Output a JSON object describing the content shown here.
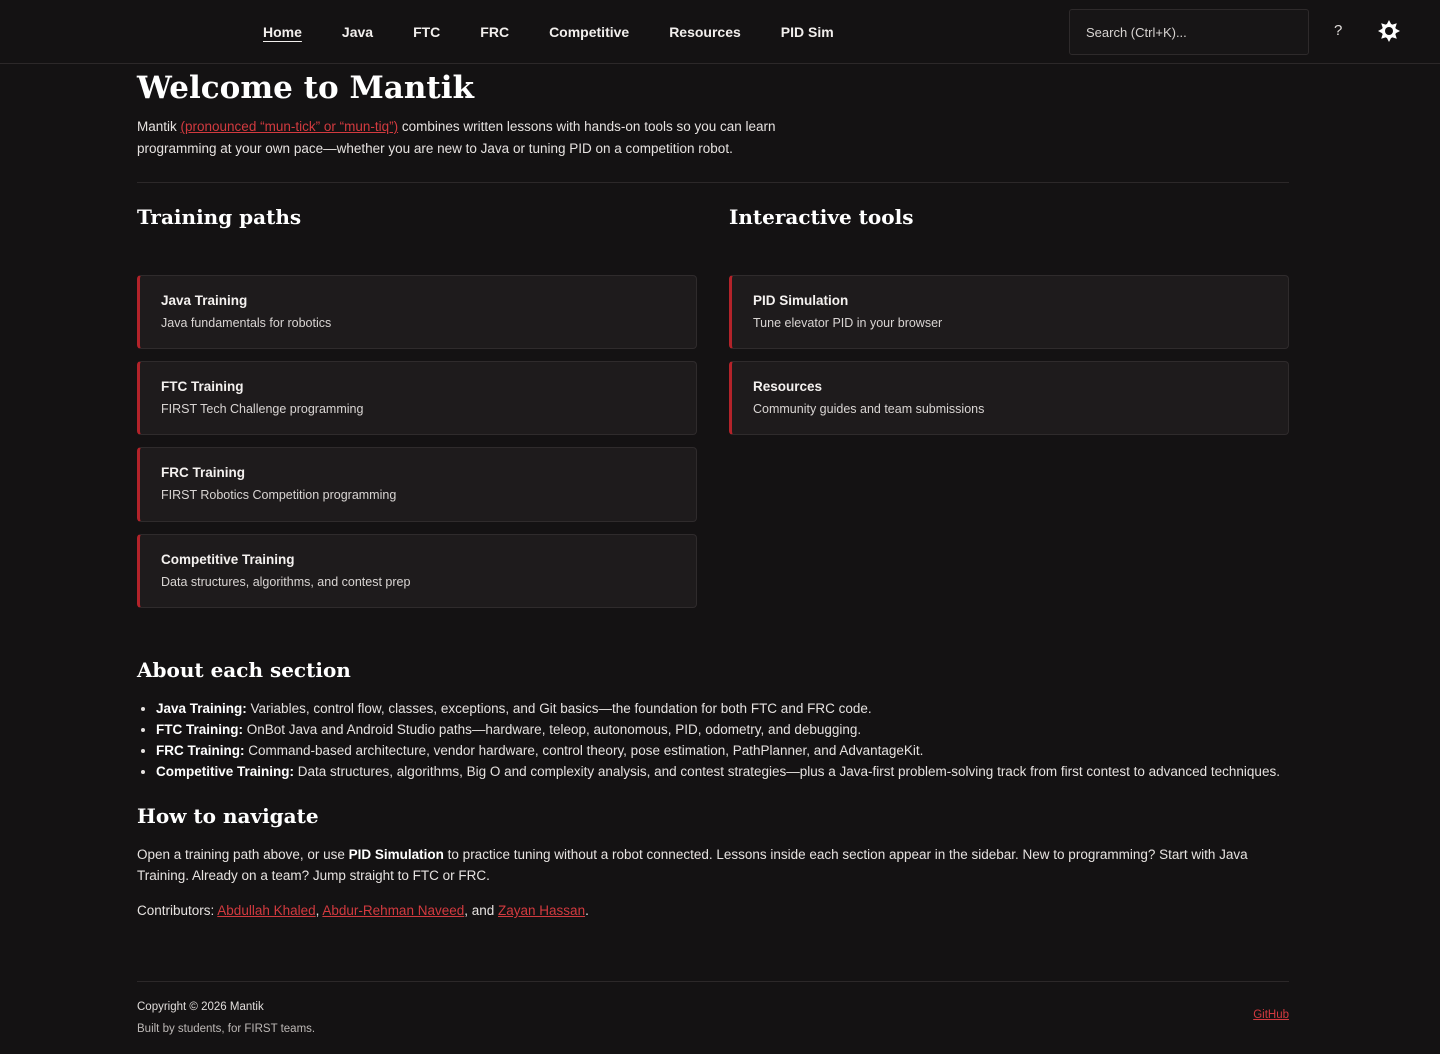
{
  "nav": {
    "items": [
      "Home",
      "Java",
      "FTC",
      "FRC",
      "Competitive",
      "Resources",
      "PID Sim"
    ],
    "active": "Home"
  },
  "search": {
    "placeholder": "Search (Ctrl+K)..."
  },
  "help_label": "?",
  "page": {
    "title": "Welcome to Mantik",
    "intro_prefix": "Mantik ",
    "intro_link": "(pronounced “mun-tick” or “mun-tiq”)",
    "intro_suffix": " combines written lessons with hands-on tools so you can learn programming at your own pace—whether you are new to Java or tuning PID on a competition robot."
  },
  "training": {
    "heading": "Training paths",
    "cards": [
      {
        "title": "Java Training",
        "desc": "Java fundamentals for robotics"
      },
      {
        "title": "FTC Training",
        "desc": "FIRST Tech Challenge programming"
      },
      {
        "title": "FRC Training",
        "desc": "FIRST Robotics Competition programming"
      },
      {
        "title": "Competitive Training",
        "desc": "Data structures, algorithms, and contest prep"
      }
    ]
  },
  "tools": {
    "heading": "Interactive tools",
    "cards": [
      {
        "title": "PID Simulation",
        "desc": "Tune elevator PID in your browser"
      },
      {
        "title": "Resources",
        "desc": "Community guides and team submissions"
      }
    ]
  },
  "about": {
    "heading": "About each section",
    "items": [
      {
        "label": "Java Training:",
        "text": " Variables, control flow, classes, exceptions, and Git basics—the foundation for both FTC and FRC code."
      },
      {
        "label": "FTC Training:",
        "text": " OnBot Java and Android Studio paths—hardware, teleop, autonomous, PID, odometry, and debugging."
      },
      {
        "label": "FRC Training:",
        "text": " Command-based architecture, vendor hardware, control theory, pose estimation, PathPlanner, and AdvantageKit."
      },
      {
        "label": "Competitive Training:",
        "text": " Data structures, algorithms, Big O and complexity analysis, and contest strategies—plus a Java-first problem-solving track from first contest to advanced techniques."
      }
    ]
  },
  "howto": {
    "heading": "How to navigate",
    "text_before": "Open a training path above, or use ",
    "bold": "PID Simulation",
    "text_after": " to practice tuning without a robot connected. Lessons inside each section appear in the sidebar. New to programming? Start with Java Training. Already on a team? Jump straight to FTC or FRC."
  },
  "contributors": {
    "label": "Contributors: ",
    "names": [
      "Abdullah Khaled",
      "Abdur-Rehman Naveed",
      "Zayan Hassan"
    ],
    "sep1": ", ",
    "sep2": ", and ",
    "end": "."
  },
  "footer": {
    "copyright": "Copyright © 2026 Mantik",
    "tagline": "Built by students, for FIRST teams.",
    "github": "GitHub"
  },
  "colors": {
    "accent": "#b3232a",
    "link": "#d23a3f",
    "background": "#141213",
    "card": "#1e1b1c"
  }
}
